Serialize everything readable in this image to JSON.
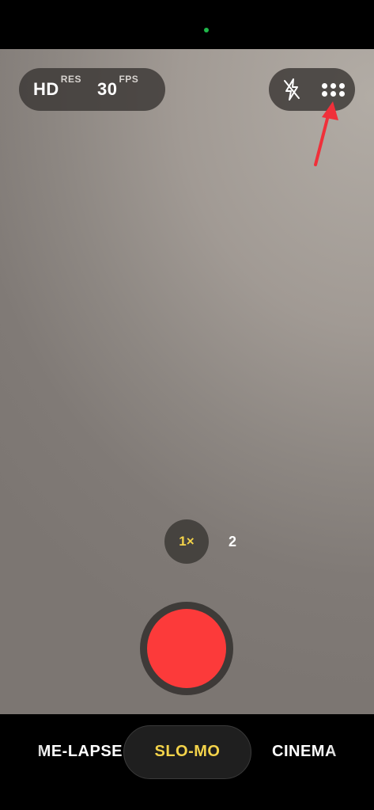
{
  "top_bar": {
    "camera_indicator_color": "#1fb84a"
  },
  "settings_pill": {
    "resolution_value": "HD",
    "resolution_unit": "RES",
    "fps_value": "30",
    "fps_unit": "FPS"
  },
  "controls": {
    "flash_icon": "flash-off-icon",
    "more_icon": "more-dots-icon"
  },
  "annotation": {
    "arrow_color": "#f0303a"
  },
  "zoom": {
    "active": "1×",
    "other": "2",
    "active_color": "#f3d34a"
  },
  "shutter": {
    "color": "#fc3a3a"
  },
  "modes": {
    "items": [
      "TIME-LAPSE",
      "SLO-MO",
      "CINEMATIC"
    ],
    "visible_text": [
      "ME-LAPSE",
      "SLO-MO",
      "CINEMA"
    ],
    "selected": "SLO-MO",
    "selected_color": "#f3d34a"
  }
}
